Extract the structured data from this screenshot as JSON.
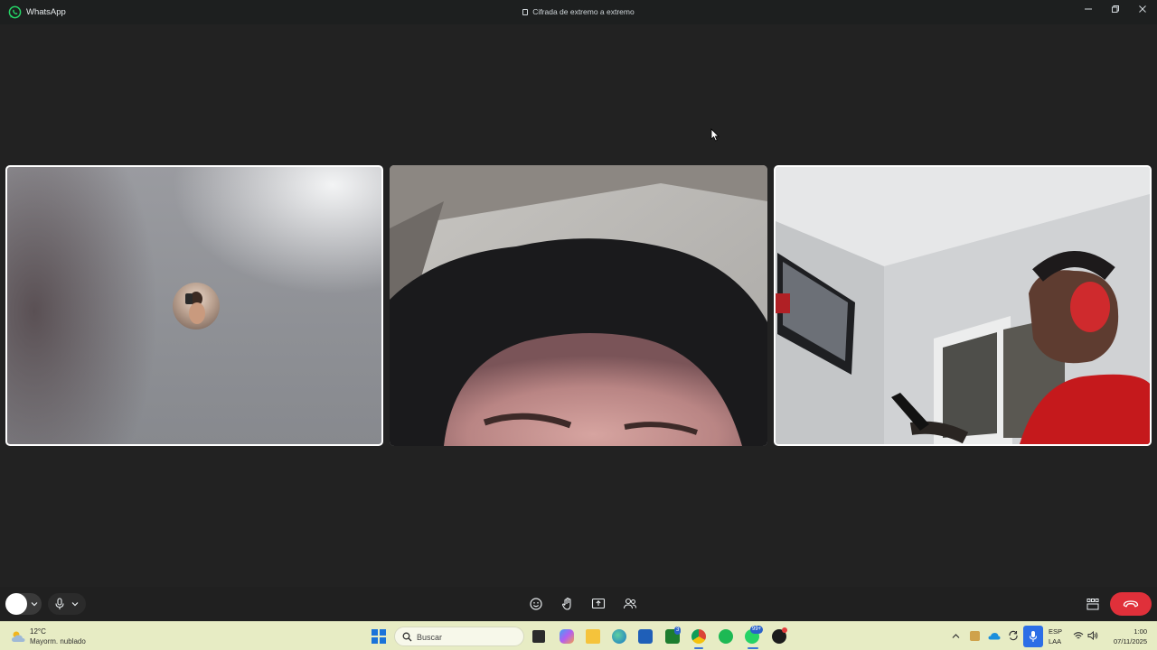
{
  "titlebar": {
    "app_name": "WhatsApp",
    "encryption": "Cifrada de extremo a extremo",
    "icons": [
      "whatsapp-logo",
      "lock-icon",
      "minimize-icon",
      "restore-icon",
      "close-icon"
    ]
  },
  "call": {
    "participants": [
      {
        "id": "participant-1",
        "video": "off",
        "selected": true
      },
      {
        "id": "participant-2",
        "video": "on",
        "selected": false
      },
      {
        "id": "participant-3",
        "video": "on",
        "selected": true
      }
    ],
    "controls": [
      "camera-toggle",
      "camera-options-chevron",
      "microphone",
      "microphone-options-chevron",
      "emoji-reaction",
      "raise-hand",
      "share-screen",
      "add-participant",
      "layout-grid",
      "end-call"
    ],
    "end_call_color": "#e0303a"
  },
  "taskbar": {
    "weather": {
      "temperature": "12°C",
      "condition": "Mayorm. nublado"
    },
    "search_placeholder": "Buscar",
    "apps": [
      {
        "name": "task-view",
        "badge": ""
      },
      {
        "name": "copilot",
        "badge": ""
      },
      {
        "name": "file-explorer",
        "badge": ""
      },
      {
        "name": "edge",
        "badge": ""
      },
      {
        "name": "store",
        "badge": ""
      },
      {
        "name": "xbox",
        "badge": "3"
      },
      {
        "name": "chrome",
        "badge": ""
      },
      {
        "name": "spotify",
        "badge": ""
      },
      {
        "name": "whatsapp",
        "badge": "99+"
      },
      {
        "name": "app-black",
        "badge": ""
      }
    ],
    "tray": {
      "language_line1": "ESP",
      "language_line2": "LAA",
      "time": "1:00",
      "date": "07/11/2025"
    }
  },
  "colors": {
    "accent": "#25d366",
    "background": "#222222",
    "taskbar": "#e7ecc4"
  }
}
